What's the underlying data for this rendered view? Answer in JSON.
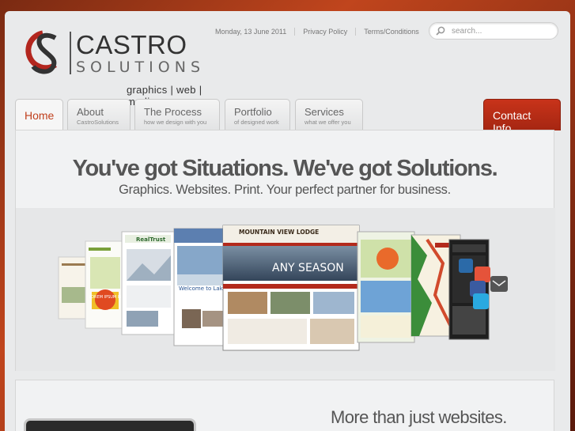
{
  "header": {
    "logo_name": "CASTRO",
    "logo_sub": "SOLUTIONS",
    "logo_tagline": "graphics | web | media",
    "date": "Monday, 13 June 2011",
    "links": [
      "Privacy Policy",
      "Terms/Conditions"
    ],
    "search_placeholder": "search..."
  },
  "tabs": [
    {
      "title": "Home",
      "subtitle": ""
    },
    {
      "title": "About",
      "subtitle": "CastroSolutions"
    },
    {
      "title": "The Process",
      "subtitle": "how we design with you"
    },
    {
      "title": "Portfolio",
      "subtitle": "of designed work"
    },
    {
      "title": "Services",
      "subtitle": "what we offer you"
    }
  ],
  "contact_label": "Contact Info",
  "hero": {
    "headline": "You've got Situations. We've got Solutions.",
    "subline": "Graphics. Websites. Print. Your perfect partner for business."
  },
  "showcase": {
    "featured_title": "MOUNTAIN VIEW LODGE",
    "featured_banner": "ANY SEASON",
    "featured_welcome": "Welcome to Lake Ch",
    "realtrust_label": "RealTrust",
    "lorem_badge": "LOREM IPSUM IS"
  },
  "second": {
    "title": "More than just websites."
  },
  "colors": {
    "accent": "#c0401e",
    "contact_bg": "#b02b15",
    "text": "#555555"
  }
}
